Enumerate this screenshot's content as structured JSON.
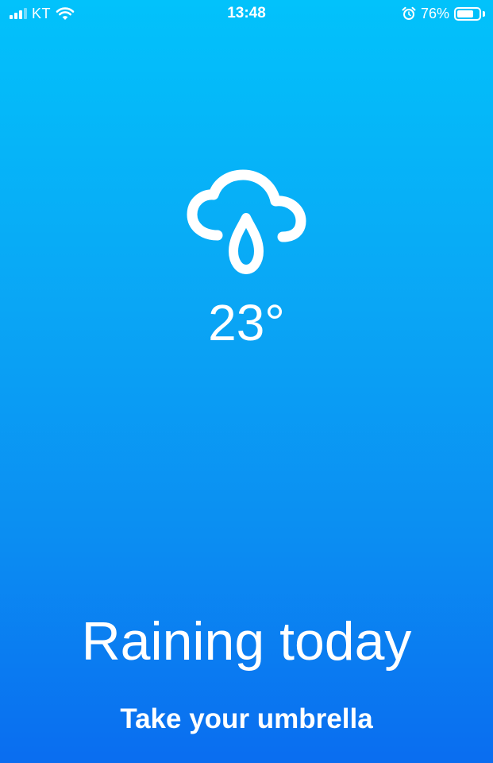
{
  "status_bar": {
    "carrier": "KT",
    "time": "13:48",
    "battery_percent": "76%",
    "battery_level": 0.76,
    "signal_bars_active": 3,
    "signal_bars_total": 4,
    "icons": [
      "signal-icon",
      "wifi-icon",
      "alarm-icon",
      "battery-icon"
    ]
  },
  "weather": {
    "icon": "cloud-rain-icon",
    "temperature": "23°",
    "headline": "Raining today",
    "subline": "Take your umbrella"
  },
  "colors": {
    "background_top": "#02c2fb",
    "background_bottom": "#0a6df0",
    "foreground": "#ffffff"
  }
}
